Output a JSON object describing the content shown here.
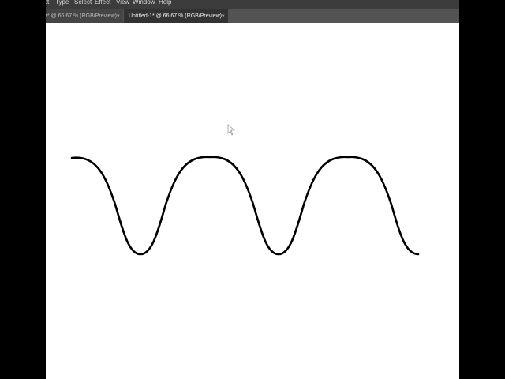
{
  "menu": {
    "items": [
      "ct",
      "Type",
      "Select",
      "Effect",
      "View",
      "Window",
      "Help"
    ]
  },
  "tabs": [
    {
      "label": "a* @ 66.67 % (RGB/Preview)",
      "close": "×",
      "active": false
    },
    {
      "label": "Untitled-1* @ 66.67 % (RGB/Preview)",
      "close": "×",
      "active": true
    }
  ],
  "colors": {
    "menubar": "#3c3c3c",
    "tabbar": "#535353",
    "tab_active": "#323232",
    "tab_inactive": "#454545",
    "artboard": "#ffffff",
    "stroke": "#000000"
  },
  "artwork": {
    "shape": "sine-wave-path",
    "cursor": "pointer-cursor-icon"
  }
}
